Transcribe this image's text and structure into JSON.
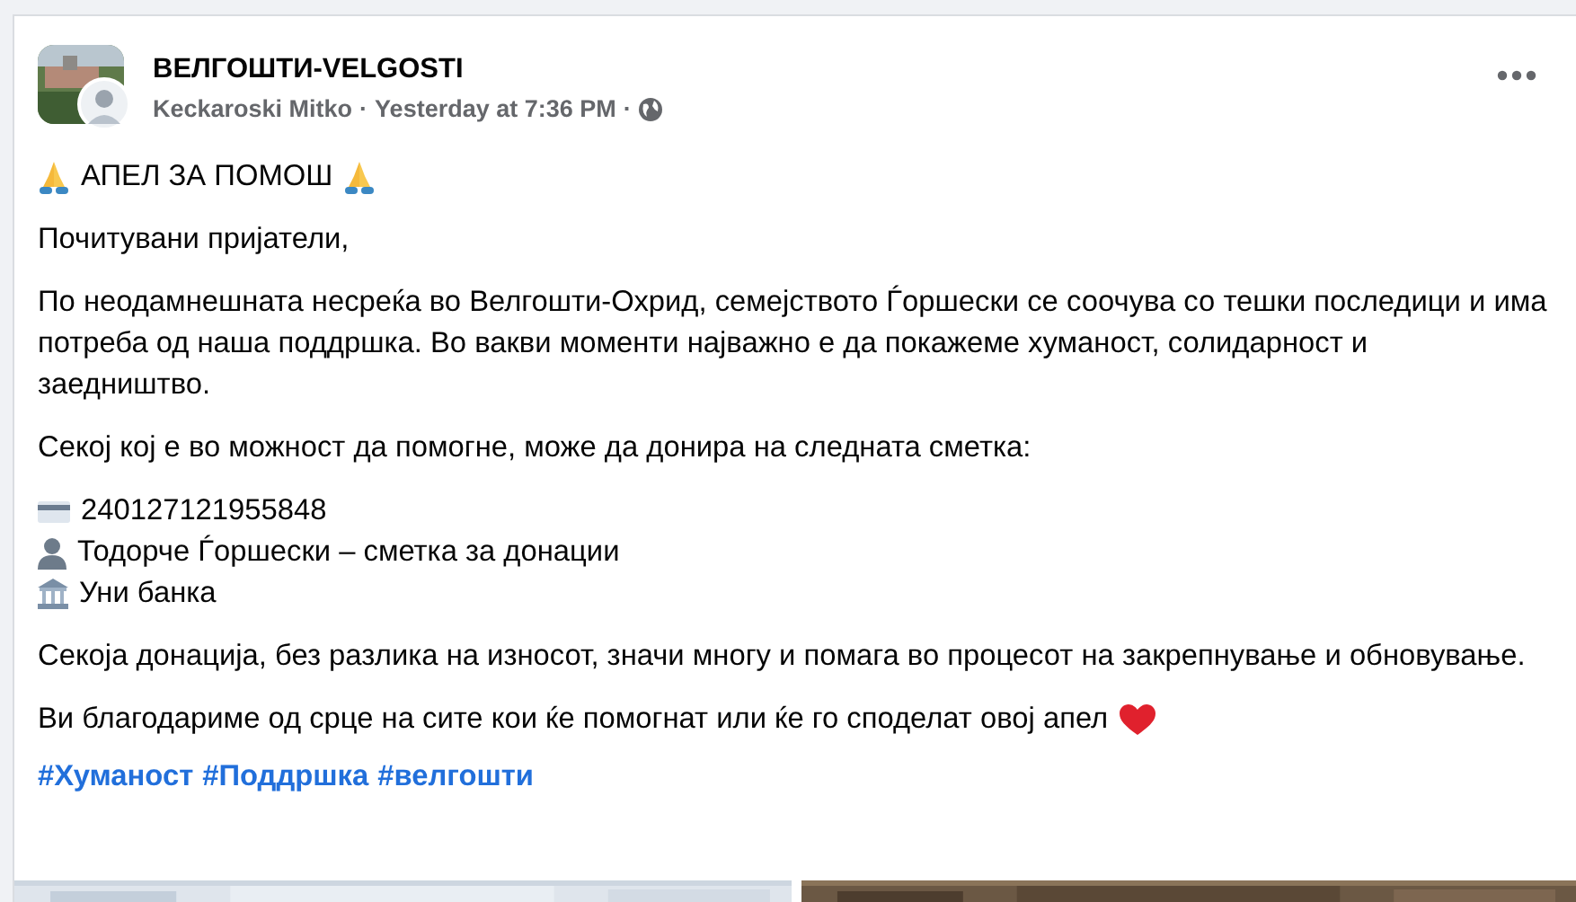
{
  "post": {
    "page_name": "ВЕЛГОШТИ-VELGOSTI",
    "author": "Keckaroski Mitko",
    "separator": "·",
    "time": "Yesterday at 7:36 PM"
  },
  "body": [
    {
      "kind": "title",
      "text": "АПЕЛ ЗА ПОМОШ"
    },
    {
      "kind": "paragraph",
      "text": "Почитувани пријатели,"
    },
    {
      "kind": "paragraph",
      "text": "По неодамнешната несреќа во Велгошти-Охрид, семејството Ѓоршески се соочува со тешки последици и има потреба од наша поддршка. Во вакви моменти најважно е да покажеме хуманост, солидарност и заедништво."
    },
    {
      "kind": "paragraph",
      "text": "Секој кој е во можност да помогне, може да донира на следната сметка:"
    },
    {
      "kind": "list",
      "items": [
        {
          "kind": "card",
          "text": "240127121955848"
        },
        {
          "kind": "person",
          "text": "Тодорче Ѓоршески – сметка за донации"
        },
        {
          "kind": "bank",
          "text": "Уни банка"
        }
      ]
    },
    {
      "kind": "paragraph",
      "text": "Секоја донација, без разлика на износот, значи многу и помага во процесот на закрепнување и обновување."
    },
    {
      "kind": "closing",
      "text": "Ви благодариме од срце на сите кои ќе помогнат или ќе го споделат овој апел"
    }
  ],
  "hashtags": [
    "#Хуманост",
    "#Поддршка",
    "#велгошти"
  ]
}
